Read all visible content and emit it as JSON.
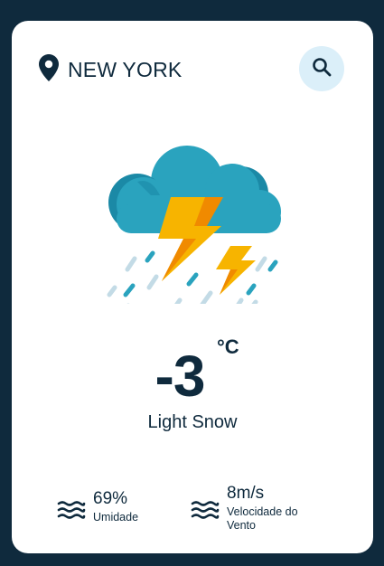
{
  "location": {
    "city": "NEW YORK",
    "icon": "map-pin-icon"
  },
  "search": {
    "icon": "search-icon"
  },
  "weather": {
    "icon": "thunderstorm-rain-icon",
    "temperature": "-3",
    "unit": "°C",
    "condition": "Light Snow"
  },
  "stats": {
    "humidity": {
      "value": "69%",
      "label": "Umidade",
      "icon": "waves-icon"
    },
    "wind": {
      "value": "8m/s",
      "label_line1": "Velocidade do",
      "label_line2": "Vento",
      "icon": "waves-icon"
    }
  },
  "colors": {
    "background": "#0f2a3d",
    "card": "#ffffff",
    "text": "#0f2a3d",
    "search_bg": "#dbeff9",
    "cloud": "#2aa3be",
    "cloud_dark": "#1b89a6",
    "lightning": "#f7b400",
    "lightning_dark": "#f08a00",
    "rain_light": "#c3dbe6",
    "rain_dark": "#2aa3be"
  }
}
